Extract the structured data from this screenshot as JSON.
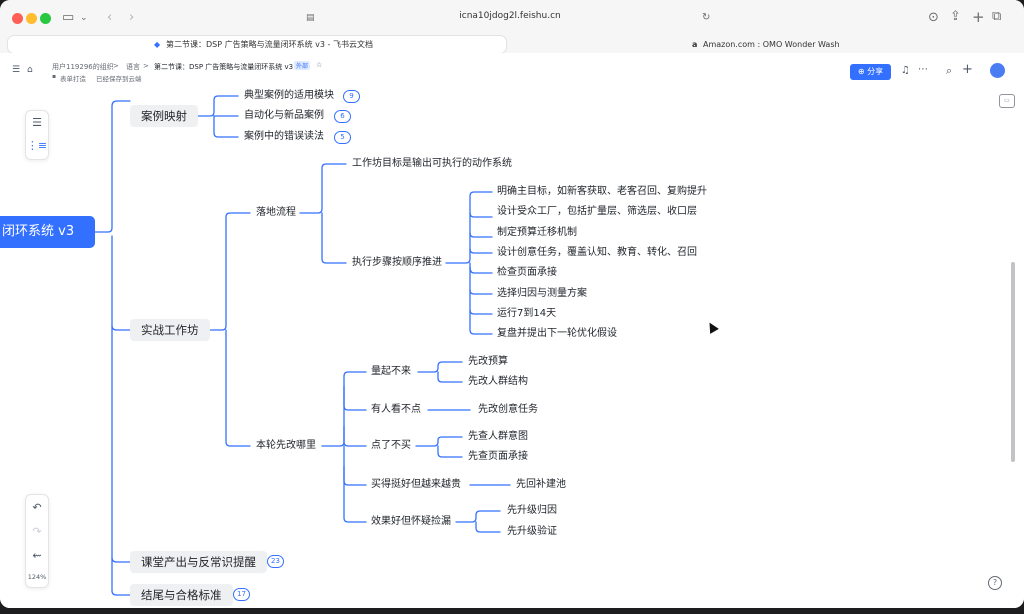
{
  "browser": {
    "url": "icna10jdog2l.feishu.cn",
    "tabs": [
      {
        "title": "第二节课：DSP 广告策略与流量闭环系统 v3 - 飞书云文档",
        "active": true
      },
      {
        "title": "Amazon.com : OMO Wonder Wash",
        "active": false
      }
    ]
  },
  "header": {
    "org": "用户119296的组织",
    "sep": ">",
    "parent": "语言",
    "doc_title": "第二节课：DSP 广告策略与流量闭环系统 v3",
    "tag": "外部",
    "tag2": "表单打造",
    "save_status": "已经保存到云端",
    "share_label": "分享"
  },
  "mindmap": {
    "root": "闭环系统 v3",
    "branches": [
      {
        "label": "案例映射",
        "children": [
          {
            "label": "典型案例的适用模块",
            "badge": "9"
          },
          {
            "label": "自动化与新品案例",
            "badge": "6"
          },
          {
            "label": "案例中的错误读法",
            "badge": "5"
          }
        ]
      },
      {
        "label": "实战工作坊",
        "children": [
          {
            "label": "落地流程",
            "children": [
              {
                "label": "工作坊目标是输出可执行的动作系统"
              },
              {
                "label": "执行步骤按顺序推进",
                "children": [
                  {
                    "label": "明确主目标，如新客获取、老客召回、复购提升"
                  },
                  {
                    "label": "设计受众工厂，包括扩量层、筛选层、收口层"
                  },
                  {
                    "label": "制定预算迁移机制"
                  },
                  {
                    "label": "设计创意任务，覆盖认知、教育、转化、召回"
                  },
                  {
                    "label": "检查页面承接"
                  },
                  {
                    "label": "选择归因与测量方案"
                  },
                  {
                    "label": "运行7到14天"
                  },
                  {
                    "label": "复盘并提出下一轮优化假设"
                  }
                ]
              }
            ]
          },
          {
            "label": "本轮先改哪里",
            "children": [
              {
                "label": "量起不来",
                "children": [
                  {
                    "label": "先改预算"
                  },
                  {
                    "label": "先改人群结构"
                  }
                ]
              },
              {
                "label": "有人看不点",
                "children": [
                  {
                    "label": "先改创意任务"
                  }
                ]
              },
              {
                "label": "点了不买",
                "children": [
                  {
                    "label": "先查人群意图"
                  },
                  {
                    "label": "先查页面承接"
                  }
                ]
              },
              {
                "label": "买得挺好但越来越贵",
                "children": [
                  {
                    "label": "先回补建池"
                  }
                ]
              },
              {
                "label": "效果好但怀疑捡漏",
                "children": [
                  {
                    "label": "先升级归因"
                  },
                  {
                    "label": "先升级验证"
                  }
                ]
              }
            ]
          }
        ]
      },
      {
        "label": "课堂产出与反常识提醒",
        "badge": "23"
      },
      {
        "label": "结尾与合格标准",
        "badge": "17"
      }
    ]
  },
  "toolbar": {
    "zoom": "124%"
  }
}
